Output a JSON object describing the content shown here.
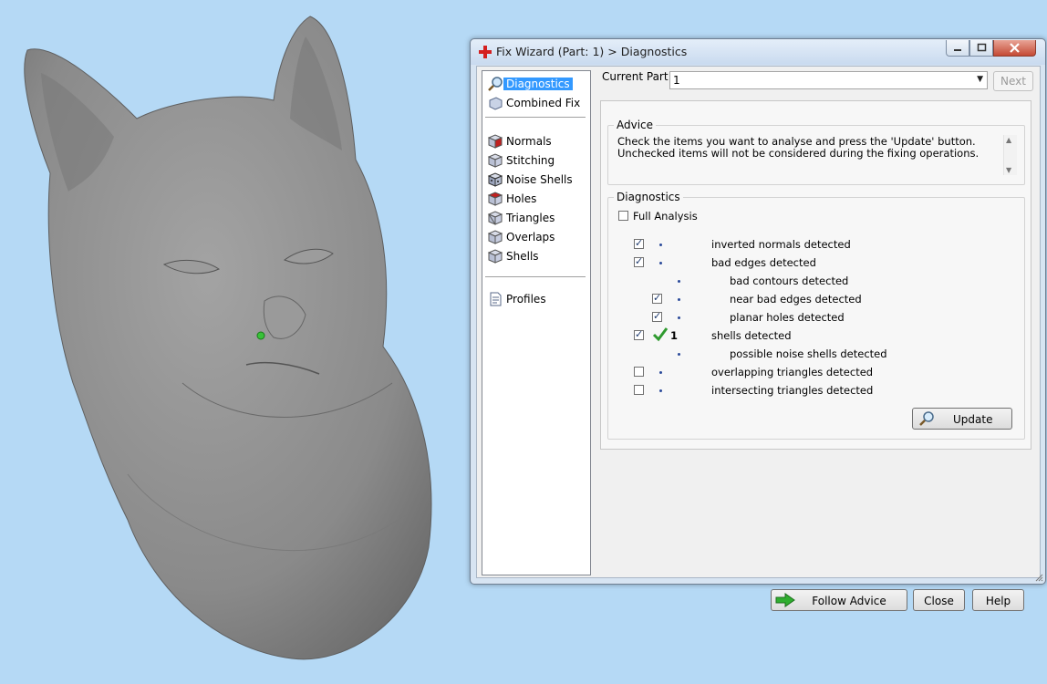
{
  "window": {
    "title": "Fix Wizard (Part: 1) > Diagnostics"
  },
  "nav": {
    "items": [
      {
        "label": "Diagnostics",
        "icon": "diagnostics-magnifier-icon",
        "selected": true
      },
      {
        "label": "Combined Fix",
        "icon": "combined-fix-icon"
      },
      {
        "label": "Normals",
        "icon": "normals-cube-icon"
      },
      {
        "label": "Stitching",
        "icon": "stitching-cube-icon"
      },
      {
        "label": "Noise Shells",
        "icon": "noise-shells-cube-icon"
      },
      {
        "label": "Holes",
        "icon": "holes-cube-icon"
      },
      {
        "label": "Triangles",
        "icon": "triangles-cube-icon"
      },
      {
        "label": "Overlaps",
        "icon": "overlaps-cube-icon"
      },
      {
        "label": "Shells",
        "icon": "shells-cube-icon"
      },
      {
        "label": "Profiles",
        "icon": "profiles-document-icon"
      }
    ]
  },
  "current_part": {
    "label": "Current Part:",
    "value": "1"
  },
  "next_label": "Next",
  "advice": {
    "title": "Advice",
    "text": "Check the items you want to analyse and press the 'Update' button. Unchecked items will not be considered during the fixing operations."
  },
  "diagnostics": {
    "title": "Diagnostics",
    "full_analysis_label": "Full Analysis",
    "full_analysis_checked": false,
    "rows": [
      {
        "label": "inverted normals detected",
        "checked": true,
        "has_checkbox": true,
        "indent": 0,
        "result": ""
      },
      {
        "label": "bad edges detected",
        "checked": true,
        "has_checkbox": true,
        "indent": 0,
        "result": ""
      },
      {
        "label": "bad contours detected",
        "checked": false,
        "has_checkbox": false,
        "indent": 1,
        "result": ""
      },
      {
        "label": "near bad edges detected",
        "checked": true,
        "has_checkbox": true,
        "indent": 1,
        "result": ""
      },
      {
        "label": "planar holes detected",
        "checked": true,
        "has_checkbox": true,
        "indent": 1,
        "result": ""
      },
      {
        "label": "shells detected",
        "checked": true,
        "has_checkbox": true,
        "indent": 0,
        "result": "1",
        "ok": true
      },
      {
        "label": "possible noise shells detected",
        "checked": false,
        "has_checkbox": false,
        "indent": 1,
        "result": ""
      },
      {
        "label": "overlapping triangles detected",
        "checked": false,
        "has_checkbox": true,
        "indent": 0,
        "result": ""
      },
      {
        "label": "intersecting triangles detected",
        "checked": false,
        "has_checkbox": true,
        "indent": 0,
        "result": ""
      }
    ],
    "update_label": "Update"
  },
  "buttons": {
    "follow_advice": "Follow Advice",
    "close": "Close",
    "help": "Help"
  },
  "colors": {
    "background": "#b5d9f5",
    "model": "#8f8f8f",
    "selection": "#3399ff",
    "ok_check": "#2f9a2f"
  }
}
